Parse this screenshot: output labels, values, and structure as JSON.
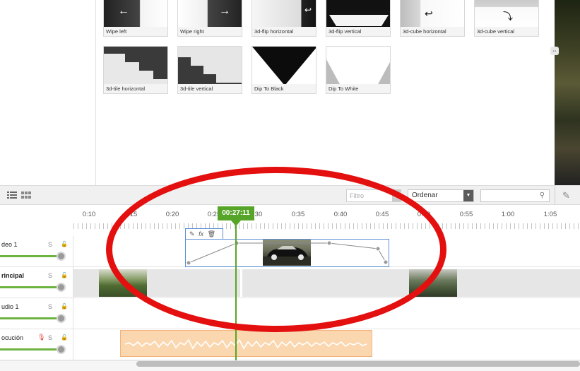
{
  "transitions": {
    "items": [
      {
        "label": "Wipe left"
      },
      {
        "label": "Wipe right"
      },
      {
        "label": "3d-flip horizontal"
      },
      {
        "label": "3d-flip vertical"
      },
      {
        "label": "3d-cube horizontal"
      },
      {
        "label": "3d-cube vertical"
      },
      {
        "label": "3d-tile horizontal"
      },
      {
        "label": "3d-tile vertical"
      },
      {
        "label": "Dip To Black"
      },
      {
        "label": "Dip To White"
      }
    ]
  },
  "toolbar": {
    "filter_placeholder": "Filtro",
    "sort_label": "Ordenar",
    "search_value": ""
  },
  "ruler": {
    "labels": [
      "0:10",
      "0:15",
      "0:20",
      "0:25",
      "0:30",
      "0:35",
      "0:40",
      "0:45",
      "0:50",
      "0:55",
      "1:00",
      "1:05"
    ]
  },
  "playhead": {
    "time": "00:27:11"
  },
  "tracks": [
    {
      "name": "deo 1",
      "solo": "S",
      "volume": 1.0
    },
    {
      "name": "rincipal",
      "solo": "S",
      "volume": 1.0
    },
    {
      "name": "udio 1",
      "solo": "S",
      "volume": 1.0
    },
    {
      "name": "ocución",
      "solo": "S",
      "volume": 1.0
    }
  ],
  "clip_tab": {
    "fx_label": "fx"
  },
  "colors": {
    "accent_green": "#56a528",
    "annotation_red": "#e3100f",
    "clip_border_blue": "#5b8fd6",
    "audio_clip_fill": "#fbd7b0"
  }
}
